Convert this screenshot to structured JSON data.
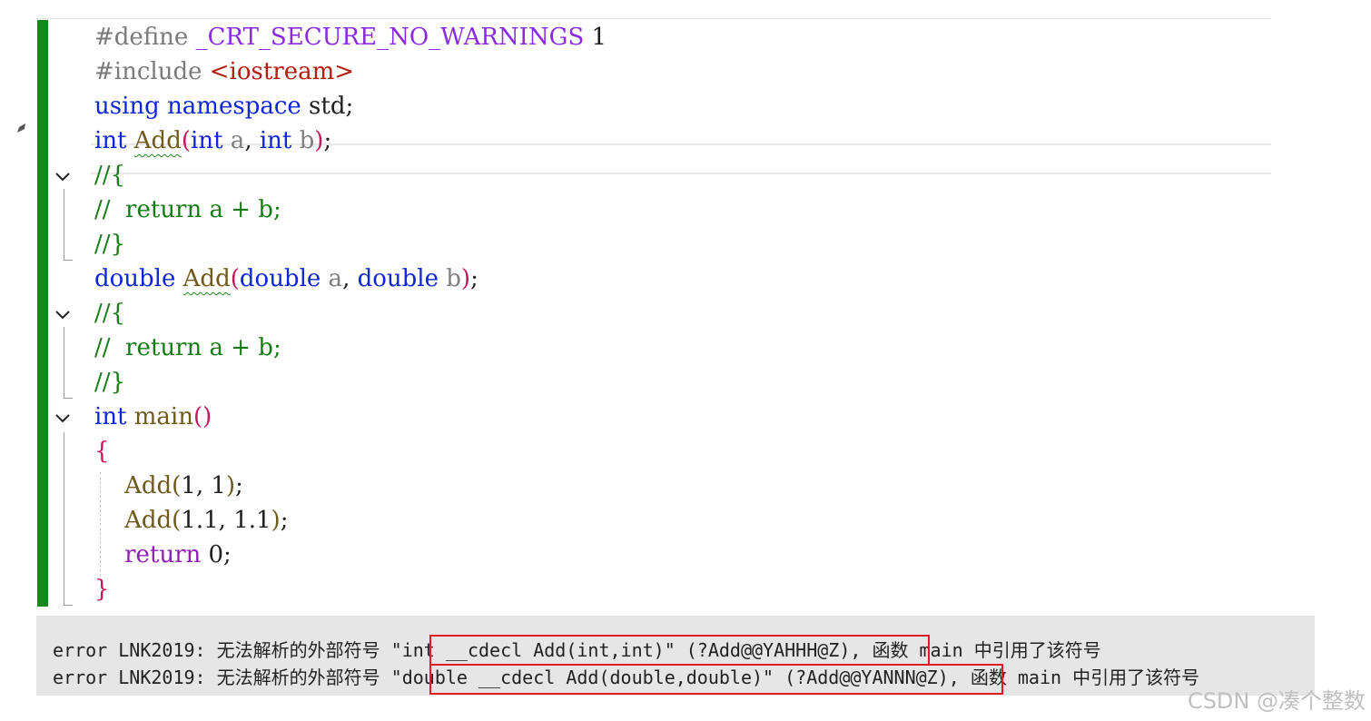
{
  "editor": {
    "lines": [
      {
        "p": [
          "#define",
          " ",
          "_CRT_SECURE_NO_WARNINGS",
          " 1"
        ]
      },
      {
        "p": [
          "#include",
          " ",
          "<iostream>"
        ]
      },
      {
        "p": [
          "using",
          " ",
          "namespace",
          " std;"
        ]
      },
      {
        "p": [
          "int",
          " ",
          "Add",
          "(",
          "int",
          " ",
          "a",
          ", ",
          "int",
          " ",
          "b",
          ")",
          ";"
        ]
      },
      {
        "p": [
          "//{"
        ]
      },
      {
        "p": [
          "//  return a + b;"
        ]
      },
      {
        "p": [
          "//}"
        ]
      },
      {
        "p": [
          "double",
          " ",
          "Add",
          "(",
          "double",
          " ",
          "a",
          ", ",
          "double",
          " ",
          "b",
          ")",
          ";"
        ]
      },
      {
        "p": [
          "//{"
        ]
      },
      {
        "p": [
          "//  return a + b;"
        ]
      },
      {
        "p": [
          "//}"
        ]
      },
      {
        "p": [
          "int",
          " ",
          "main",
          "()"
        ]
      },
      {
        "p": [
          "{"
        ]
      },
      {
        "p": [
          "    ",
          "Add",
          "(",
          "1",
          ", ",
          "1",
          ")",
          ";"
        ]
      },
      {
        "p": [
          "    ",
          "Add",
          "(",
          "1.1",
          ", ",
          "1.1",
          ")",
          ";"
        ]
      },
      {
        "p": [
          "    ",
          "return",
          " 0;"
        ]
      },
      {
        "p": [
          "}"
        ]
      }
    ]
  },
  "errors": [
    {
      "prefix": "error LNK2019: 无法解析的外部符号 \"",
      "highlight": "int __cdecl Add(int,int)\" (?Add@@YAHHH@Z),",
      "suffix": " 函数 main 中引用了该符号"
    },
    {
      "prefix": "error LNK2019: 无法解析的外部符号 \"",
      "highlight": "double __cdecl Add(double,double)\" (?Add@@YANNN@Z),",
      "suffix": " 函数 main 中引用了该符号"
    }
  ],
  "watermark": "CSDN @凑个整数",
  "colors": {
    "change_bar": "#16891a",
    "highlight_box": "#e21c22",
    "keyword": "#0d27d6",
    "comment": "#157b15"
  }
}
